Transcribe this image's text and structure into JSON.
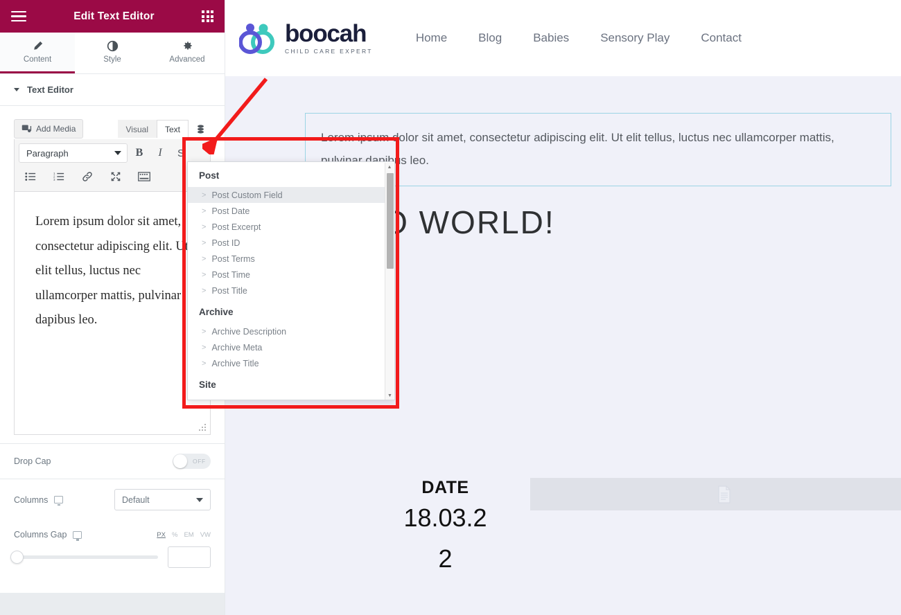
{
  "panel": {
    "title": "Edit Text Editor",
    "menu_icon": "hamburger-icon",
    "grid_icon": "apps-grid-icon",
    "tabs": [
      {
        "label": "Content",
        "icon": "pencil-icon",
        "active": true
      },
      {
        "label": "Style",
        "icon": "contrast-icon",
        "active": false
      },
      {
        "label": "Advanced",
        "icon": "gear-icon",
        "active": false
      }
    ],
    "section": {
      "title": "Text Editor",
      "expanded": true
    },
    "editor": {
      "add_media_label": "Add Media",
      "mode_tabs": [
        {
          "label": "Visual",
          "active": false
        },
        {
          "label": "Text",
          "active": true
        }
      ],
      "dynamic_tags_icon": "database-stack-icon",
      "format_select": "Paragraph",
      "tool_bold": "B",
      "tool_italic": "I",
      "tools_row2": [
        "bulleted-list-icon",
        "numbered-list-icon",
        "link-icon",
        "fullscreen-icon",
        "toolbar-toggle-icon"
      ],
      "content": "Lorem ipsum dolor sit amet, consectetur adipiscing elit. Ut elit tellus, luctus nec ullamcorper mattis, pulvinar dapibus leo."
    },
    "drop_cap": {
      "label": "Drop Cap",
      "state": "OFF"
    },
    "columns": {
      "label": "Columns",
      "value": "Default",
      "device_icon": "desktop-icon"
    },
    "columns_gap": {
      "label": "Columns Gap",
      "device_icon": "desktop-icon",
      "units": [
        "PX",
        "%",
        "EM",
        "VW"
      ],
      "active_unit": "PX",
      "value": "",
      "slider_percent": 0
    },
    "accent_color": "#9b0a46"
  },
  "dynamic_tags": {
    "scrollbar": {
      "up_icon": "caret-up-icon",
      "down_icon": "caret-down-icon"
    },
    "groups": [
      {
        "title": "Post",
        "items": [
          {
            "label": "Post Custom Field",
            "highlighted": true
          },
          {
            "label": "Post Date",
            "highlighted": false
          },
          {
            "label": "Post Excerpt",
            "highlighted": false
          },
          {
            "label": "Post ID",
            "highlighted": false
          },
          {
            "label": "Post Terms",
            "highlighted": false
          },
          {
            "label": "Post Time",
            "highlighted": false
          },
          {
            "label": "Post Title",
            "highlighted": false
          }
        ]
      },
      {
        "title": "Archive",
        "items": [
          {
            "label": "Archive Description",
            "highlighted": false
          },
          {
            "label": "Archive Meta",
            "highlighted": false
          },
          {
            "label": "Archive Title",
            "highlighted": false
          }
        ]
      },
      {
        "title": "Site",
        "items": []
      }
    ]
  },
  "site": {
    "brand": {
      "name": "boocah",
      "tagline": "CHILD CARE EXPERT",
      "logo_colors": [
        "#5b56d6",
        "#3ec9bd"
      ]
    },
    "nav": [
      "Home",
      "Blog",
      "Babies",
      "Sensory Play",
      "Contact"
    ],
    "selected_text": "Lorem ipsum dolor sit amet, consectetur adipiscing elit. Ut elit tellus, luctus nec ullamcorper mattis, pulvinar dapibus leo.",
    "heading": "HELLO WORLD!",
    "date_label": "DATE",
    "date_value": "18.03.2",
    "date_value2": "2",
    "placeholder_icon": "document-icon",
    "background_color": "#f0f1f9",
    "selection_border_color": "#9bd4e4"
  },
  "annotation": {
    "box_color": "#f21b1b",
    "arrow_color": "#f21b1b",
    "arrow_icon": "arrow-down-left-icon"
  }
}
